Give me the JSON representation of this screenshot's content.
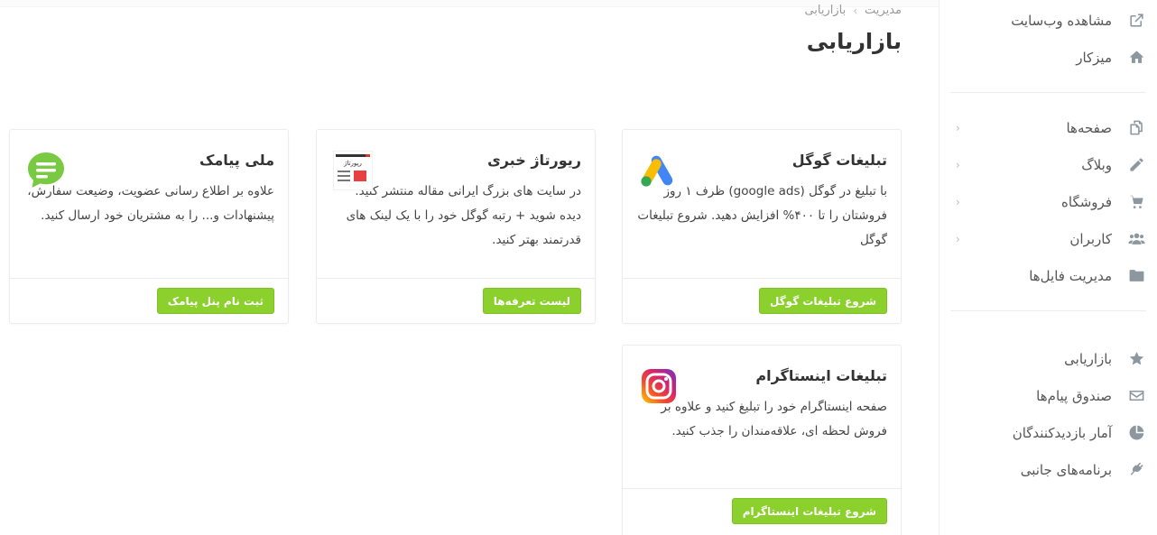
{
  "sidebar": {
    "top_items": [
      {
        "label": "مشاهده وب‌سایت",
        "icon": "external-link-icon"
      },
      {
        "label": "میزکار",
        "icon": "home-icon"
      }
    ],
    "content_items": [
      {
        "label": "صفحه‌ها",
        "icon": "pages-icon",
        "chevron": "‹"
      },
      {
        "label": "وبلاگ",
        "icon": "pencil-icon",
        "chevron": "‹"
      },
      {
        "label": "فروشگاه",
        "icon": "cart-icon",
        "chevron": "‹"
      },
      {
        "label": "کاربران",
        "icon": "users-icon",
        "chevron": "‹"
      },
      {
        "label": "مدیریت فایل‌ها",
        "icon": "folder-icon",
        "chevron": ""
      }
    ],
    "tool_items": [
      {
        "label": "بازاریابی",
        "icon": "star-icon"
      },
      {
        "label": "صندوق پیام‌ها",
        "icon": "envelope-icon"
      },
      {
        "label": "آمار بازدیدکنندگان",
        "icon": "pie-chart-icon"
      },
      {
        "label": "برنامه‌های جانبی",
        "icon": "plug-icon"
      }
    ]
  },
  "header": {
    "breadcrumb": [
      "مدیریت",
      "بازاریابی"
    ],
    "breadcrumb_separator": "›",
    "title": "بازاریابی"
  },
  "cards": {
    "google": {
      "title": "تبلیغات گوگل",
      "text": "با تبلیغ در گوگل (google ads) ظرف ۱ روز فروشتان را تا ۴۰۰% افزایش دهید. شروع تبلیغات گوگل",
      "button": "شروع تبلیغات گوگل",
      "logo_icon": "google-ads-icon"
    },
    "reportage": {
      "title": "ریورتاژ خبری",
      "text": "در سایت های بزرگ ایرانی مقاله منتشر کنید. دیده شوید + رتبه گوگل خود را با یک لینک های قدرتمند بهتر کنید.",
      "button": "لیست تعرفه‌ها",
      "logo_text": "رپورتاژ",
      "logo_icon": "newspaper-icon"
    },
    "melipayamak": {
      "title": "ملی پیامک",
      "text": "علاوه بر اطلاع رسانی عضویت، وضیعت سفارش، پیشنهادات و... را به مشتریان خود ارسال کنید.",
      "button": "ثبت نام پنل پیامک",
      "logo_icon": "chat-bubble-icon"
    },
    "instagram": {
      "title": "تبلیغات اینستاگرام",
      "text": "صفحه اینستاگرام خود را تبلیغ کنید و علاوه بر فروش لحظه ای، علاقه‌مندان را جذب کنید.",
      "button": "شروع تبلیغات اینستاگرام",
      "logo_icon": "instagram-icon"
    }
  },
  "colors": {
    "accent_green": "#8bd02d",
    "sidebar_icon": "#8d97a0"
  }
}
